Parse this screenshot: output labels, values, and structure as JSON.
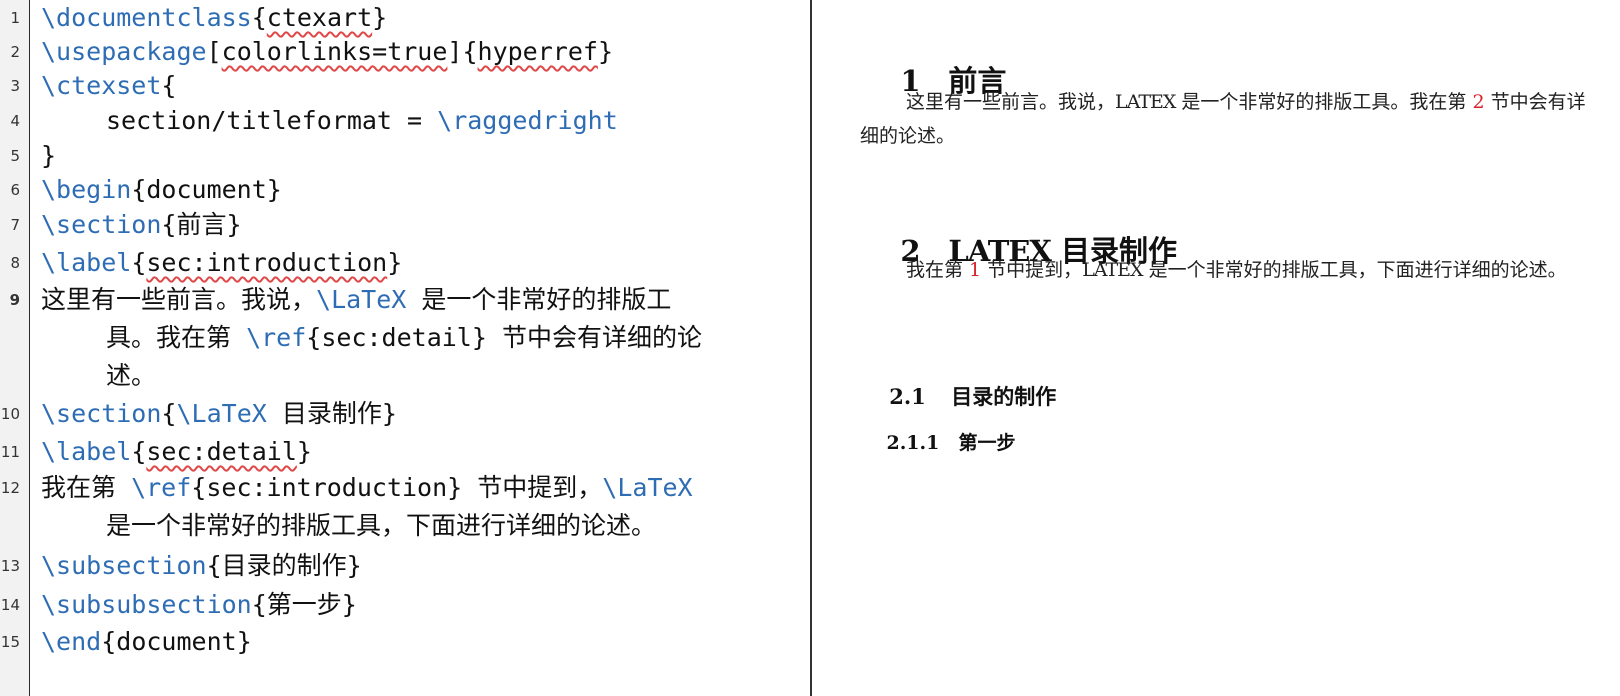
{
  "editor": {
    "line_numbers": [
      "1",
      "2",
      "3",
      "4",
      "5",
      "6",
      "7",
      "8",
      "9",
      "10",
      "11",
      "12",
      "13",
      "14",
      "15"
    ],
    "lines": {
      "l1": {
        "cmd": "\\documentclass",
        "arg": "ctexart"
      },
      "l2": {
        "cmd": "\\usepackage",
        "opt": "colorlinks=true",
        "arg": "hyperref"
      },
      "l3": {
        "cmd": "\\ctexset",
        "open": "{"
      },
      "l4": {
        "text": "section/titleformat = ",
        "cmd": "\\raggedright"
      },
      "l5": {
        "text": "}"
      },
      "l6": {
        "cmd": "\\begin",
        "arg": "document"
      },
      "l7": {
        "cmd": "\\section",
        "arg": "前言"
      },
      "l8": {
        "cmd": "\\label",
        "arg": "sec:introduction"
      },
      "l9": {
        "t1": "这里有一些前言。我说，",
        "cmd": "\\LaTeX",
        "t2": " 是一个非常好的排版工",
        "t3": "具。我在第 ",
        "ref": "\\ref",
        "refarg": "sec:detail",
        "t4": " 节中会有详细的论",
        "t5": "述。"
      },
      "l10": {
        "cmd": "\\section",
        "cmd2": "\\LaTeX",
        "t1": " 目录制作}"
      },
      "l11": {
        "cmd": "\\label",
        "arg": "sec:detail"
      },
      "l12": {
        "t1": "我在第 ",
        "ref": "\\ref",
        "refarg": "sec:introduction",
        "t2": " 节中提到，",
        "cmd": "\\LaTeX",
        "t3": "是一个非常好的排版工具，下面进行详细的论述。"
      },
      "l13": {
        "cmd": "\\subsection",
        "arg": "目录的制作"
      },
      "l14": {
        "cmd": "\\subsubsection",
        "arg": "第一步"
      },
      "l15": {
        "cmd": "\\end",
        "arg": "document"
      }
    }
  },
  "preview": {
    "section1": {
      "num": "1",
      "title": "前言"
    },
    "para1": {
      "t1": "这里有一些前言。我说，",
      "latex": "LATEX",
      "t2": " 是一个非常好的排版工具。我在第 ",
      "ref": "2",
      "t3": " 节中会有详细的论述。"
    },
    "section2": {
      "num": "2",
      "latex": "LATEX",
      "title": " 目录制作"
    },
    "para2": {
      "t1": "我在第 ",
      "ref": "1",
      "t2": " 节中提到，",
      "latex": "LATEX",
      "t3": " 是一个非常好的排版工具，下面进行详细的论述。"
    },
    "subsection": {
      "num": "2.1",
      "title": "目录的制作"
    },
    "subsubsection": {
      "num": "2.1.1",
      "title": "第一步"
    }
  },
  "colors": {
    "keyword": "#2e6db4",
    "ref": "#d9232b",
    "squiggle": "#e04848"
  }
}
